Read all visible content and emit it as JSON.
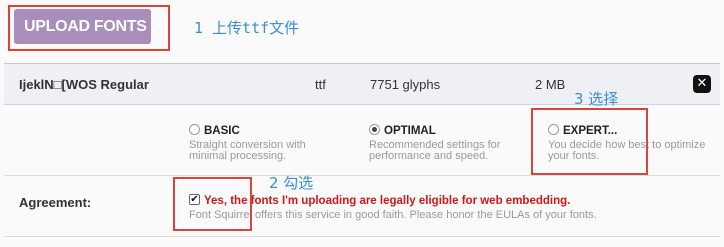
{
  "upload": {
    "label": "UPLOAD FONTS",
    "arrow_icon": "↑"
  },
  "annotations": {
    "step1": "1 上传ttf文件",
    "step2": "2 勾选",
    "step3": "3 选择"
  },
  "font_row": {
    "name": "IjeklN□[WOS Regular",
    "format": "ttf",
    "glyphs": "7751 glyphs",
    "size": "2 MB",
    "remove_icon": "✕"
  },
  "options": {
    "basic": {
      "title": "BASIC",
      "desc": "Straight conversion with minimal processing."
    },
    "optimal": {
      "title": "OPTIMAL",
      "desc": "Recommended settings for performance and speed."
    },
    "expert": {
      "title": "EXPERT...",
      "desc": "You decide how best to optimize your fonts."
    },
    "selected": "OPTIMAL"
  },
  "agreement": {
    "label": "Agreement:",
    "checkbox_checked": true,
    "text": "Yes, the fonts I'm uploading are legally eligible for web embedding.",
    "sub": "Font Squirrel offers this service in good faith. Please honor the EULAs of your fonts."
  },
  "colors": {
    "upload_button": "#a98dba",
    "annotation": "#3a8fd0",
    "annotation_box": "#d8453c",
    "agreement_text": "#cc1818"
  }
}
